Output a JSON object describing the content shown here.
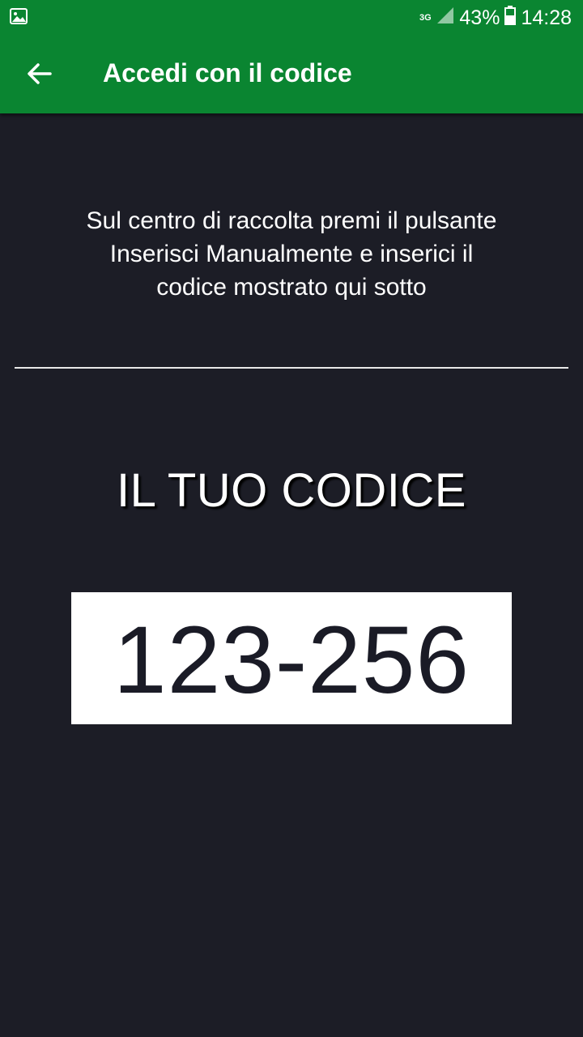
{
  "status_bar": {
    "network": "3G",
    "battery": "43%",
    "time": "14:28",
    "icons": [
      "gallery-icon",
      "signal-icon",
      "battery-icon"
    ]
  },
  "app_bar": {
    "title": "Accedi con il codice",
    "back_icon": "arrow-left-icon",
    "color": "#0a8531"
  },
  "main": {
    "instructions_lines": [
      "Sul centro di raccolta premi il pulsante",
      "Inserisci Manualmente e inserici il",
      "codice mostrato qui sotto"
    ],
    "code_heading": "IL TUO CODICE",
    "code_value": "123-256",
    "background": "#1c1d26"
  }
}
